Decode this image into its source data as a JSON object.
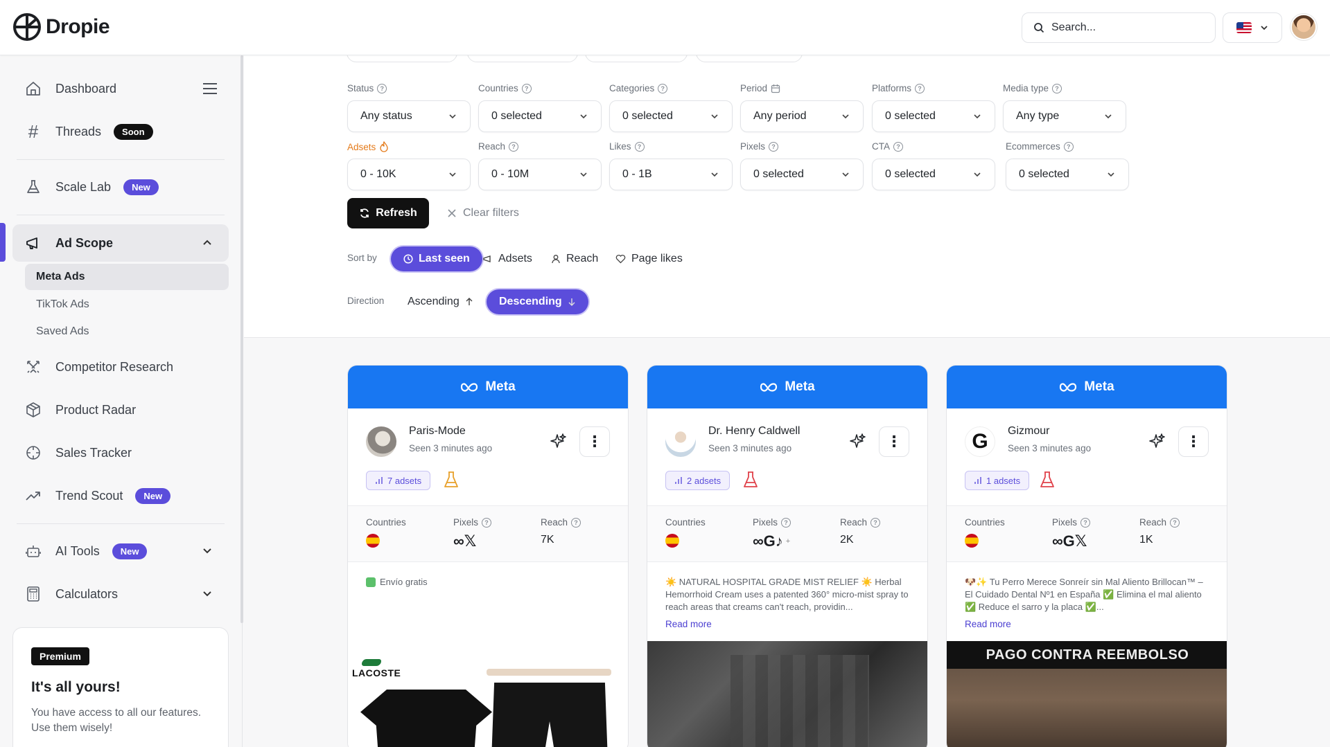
{
  "app": {
    "name": "Dropie"
  },
  "header": {
    "search_placeholder": "Search...",
    "lang_icon": "us-flag-icon"
  },
  "sidebar": {
    "items": [
      {
        "label": "Dashboard",
        "icon": "home-icon"
      },
      {
        "label": "Threads",
        "badge": "Soon",
        "icon": "hash-icon"
      },
      {
        "label": "Scale Lab",
        "badge": "New",
        "icon": "flask-icon"
      },
      {
        "label": "Ad Scope",
        "icon": "megaphone-icon"
      },
      {
        "label": "Competitor Research",
        "icon": "swords-icon"
      },
      {
        "label": "Product Radar",
        "icon": "box-icon"
      },
      {
        "label": "Sales Tracker",
        "icon": "crosshair-icon"
      },
      {
        "label": "Trend Scout",
        "badge": "New",
        "icon": "trending-up-icon"
      },
      {
        "label": "AI Tools",
        "badge": "New",
        "icon": "robot-icon"
      },
      {
        "label": "Calculators",
        "icon": "calculator-icon"
      }
    ],
    "ad_scope_sub": [
      "Meta Ads",
      "TikTok Ads",
      "Saved Ads"
    ],
    "premium": {
      "tag": "Premium",
      "title": "It's all yours!",
      "desc": "You have access to all our features. Use them wisely!"
    }
  },
  "filters": {
    "row1": [
      {
        "label": "Status",
        "value": "Any status"
      },
      {
        "label": "Countries",
        "value": "0 selected"
      },
      {
        "label": "Categories",
        "value": "0 selected"
      },
      {
        "label": "Period",
        "value": "Any period"
      },
      {
        "label": "Platforms",
        "value": "0 selected"
      },
      {
        "label": "Media type",
        "value": "Any type"
      }
    ],
    "row2": [
      {
        "label": "Adsets",
        "value": "0 - 10K"
      },
      {
        "label": "Reach",
        "value": "0 - 10M"
      },
      {
        "label": "Likes",
        "value": "0 - 1B"
      },
      {
        "label": "Pixels",
        "value": "0 selected"
      },
      {
        "label": "CTA",
        "value": "0 selected"
      },
      {
        "label": "Ecommerces",
        "value": "0 selected"
      }
    ],
    "refresh": "Refresh",
    "clear": "Clear filters"
  },
  "sort": {
    "label": "Sort by",
    "options": [
      "Last seen",
      "Adsets",
      "Reach",
      "Page likes"
    ],
    "direction_label": "Direction",
    "directions": [
      "Ascending",
      "Descending"
    ]
  },
  "cards": [
    {
      "platform": "Meta",
      "name": "Paris-Mode",
      "seen": "Seen 3 minutes ago",
      "adsets": "7 adsets",
      "flask_color": "#e8a02a",
      "countries_label": "Countries",
      "pixels_label": "Pixels",
      "reach_label": "Reach",
      "pixels": "∞𝕏",
      "reach": "7K",
      "desc": "Envío gratis",
      "read_more": ""
    },
    {
      "platform": "Meta",
      "name": "Dr. Henry Caldwell",
      "seen": "Seen 3 minutes ago",
      "adsets": "2 adsets",
      "flask_color": "#e0424a",
      "countries_label": "Countries",
      "pixels_label": "Pixels",
      "reach_label": "Reach",
      "pixels": "∞G♪",
      "reach": "2K",
      "desc": "☀️ NATURAL HOSPITAL GRADE MIST RELIEF ☀️ Herbal Hemorrhoid Cream uses a patented 360° micro-mist spray to reach areas that creams can't reach, providin...",
      "read_more": "Read more"
    },
    {
      "platform": "Meta",
      "name": "Gizmour",
      "seen": "Seen 3 minutes ago",
      "adsets": "1 adsets",
      "flask_color": "#e0424a",
      "countries_label": "Countries",
      "pixels_label": "Pixels",
      "reach_label": "Reach",
      "pixels": "∞G𝕏",
      "reach": "1K",
      "desc": "🐶✨ Tu Perro Merece Sonreír sin Mal Aliento Brillocan™ – El Cuidado Dental Nº1 en España ✅ Elimina el mal aliento ✅ Reduce el sarro y la placa ✅...",
      "read_more": "Read more"
    }
  ],
  "media": {
    "card1_brand": "LACOSTE",
    "card3_banner": "PAGO CONTRA REEMBOLSO"
  }
}
